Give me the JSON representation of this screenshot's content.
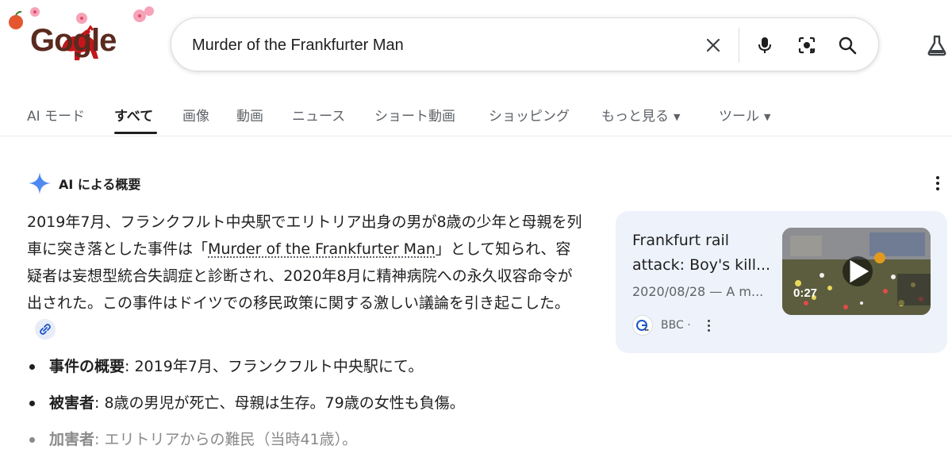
{
  "logo": {
    "text": "Gogle"
  },
  "search": {
    "query": "Murder of the Frankfurter Man",
    "clear_icon": "close-icon",
    "voice_icon": "microphone-icon",
    "lens_icon": "lens-icon",
    "search_icon": "search-icon",
    "labs_icon": "flask-icon"
  },
  "tabs": [
    {
      "label": "AI モード"
    },
    {
      "label": "すべて",
      "active": true
    },
    {
      "label": "画像"
    },
    {
      "label": "動画"
    },
    {
      "label": "ニュース"
    },
    {
      "label": "ショート動画"
    },
    {
      "label": "ショッピング"
    },
    {
      "label": "もっと見る"
    },
    {
      "label": "ツール"
    }
  ],
  "ai_overview": {
    "title": "AI による概要",
    "para_before": "2019年7月、フランクフルト中央駅でエリトリア出身の男が8歳の少年と母親を列車に突き落とした事件は「",
    "para_link": "Murder of the Frankfurter Man",
    "para_after": "」として知られ、容疑者は妄想型統合失調症と診断され、2020年8月に精神病院への永久収容命令が出された。この事件はドイツでの移民政策に関する激しい議論を引き起こした。",
    "bullets": [
      {
        "label": "事件の概要",
        "text": ": 2019年7月、フランクフルト中央駅にて。"
      },
      {
        "label": "被害者",
        "text": ": 8歳の男児が死亡、母親は生存。79歳の女性も負傷。"
      },
      {
        "label": "加害者",
        "text": ": エリトリアからの難民（当時41歳）。"
      }
    ]
  },
  "source_card": {
    "title_line1": "Frankfurt rail",
    "title_line2": "attack: Boy's kill...",
    "meta": "2020/08/28 — A m...",
    "source": "BBC ·",
    "duration": "0:27"
  },
  "colors": {
    "accent_blue": "#4285f4",
    "card_bg": "#eef2fb",
    "logo_red": "#c4161c"
  }
}
